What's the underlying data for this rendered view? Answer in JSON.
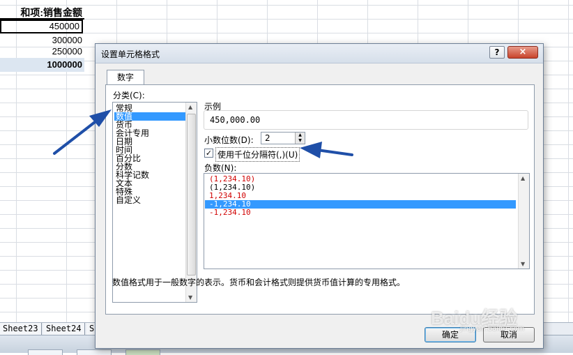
{
  "sheet": {
    "header": "和项:销售金额",
    "values": [
      "450000",
      "300000",
      "250000",
      "1000000"
    ],
    "tabs": [
      "Sheet23",
      "Sheet24",
      "S"
    ]
  },
  "dialog": {
    "title": "设置单元格格式",
    "help": "?",
    "close": "×",
    "tab": "数字",
    "category_label": "分类(C):",
    "categories": [
      "常规",
      "数值",
      "货币",
      "会计专用",
      "日期",
      "时间",
      "百分比",
      "分数",
      "科学记数",
      "文本",
      "特殊",
      "自定义"
    ],
    "selected_category": "数值",
    "sample_label": "示例",
    "sample_value": "450,000.00",
    "decimal_label": "小数位数(D):",
    "decimal_value": "2",
    "thousands_label": "使用千位分隔符(,)(U)",
    "thousands_checked": true,
    "negative_label": "负数(N):",
    "negative_options": [
      {
        "text": "(1,234.10)",
        "red": true
      },
      {
        "text": "(1,234.10)",
        "red": false
      },
      {
        "text": "1,234.10",
        "red": true
      },
      {
        "text": "-1,234.10",
        "red": false,
        "selected": true
      },
      {
        "text": "-1,234.10",
        "red": true
      }
    ],
    "description": "数值格式用于一般数字的表示。货币和会计格式则提供货币值计算的专用格式。",
    "ok": "确定",
    "cancel": "取消"
  },
  "watermark": {
    "text": "Baidu经验",
    "sub": "jingyan.baidu.com"
  },
  "colors": {
    "selection": "#3399ff",
    "arrow": "#1f4fa8",
    "negative_red": "#d00000"
  }
}
